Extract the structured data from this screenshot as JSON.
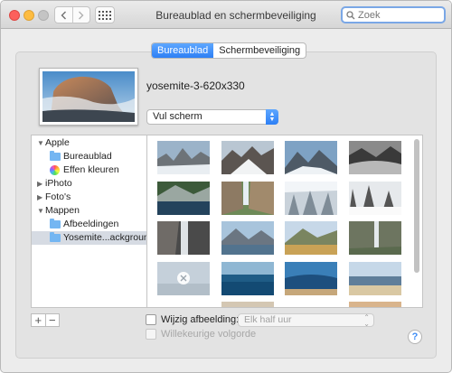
{
  "window": {
    "title": "Bureaublad en schermbeveiliging"
  },
  "search": {
    "placeholder": "Zoek"
  },
  "tabs": [
    {
      "label": "Bureaublad",
      "active": true
    },
    {
      "label": "Schermbeveiliging",
      "active": false
    }
  ],
  "preview": {
    "image_name": "yosemite-3-620x330"
  },
  "fill_popup": {
    "value": "Vul scherm"
  },
  "sidebar": {
    "items": [
      {
        "label": "Apple",
        "level": 0,
        "expanded": true,
        "icon": "disclosure-triangle-down"
      },
      {
        "label": "Bureaublad",
        "level": 1,
        "icon": "folder-icon"
      },
      {
        "label": "Effen kleuren",
        "level": 1,
        "icon": "colorwheel-icon"
      },
      {
        "label": "iPhoto",
        "level": 0,
        "expanded": false,
        "icon": "disclosure-triangle-right"
      },
      {
        "label": "Foto's",
        "level": 0,
        "expanded": false,
        "icon": "disclosure-triangle-right"
      },
      {
        "label": "Mappen",
        "level": 0,
        "expanded": true,
        "icon": "disclosure-triangle-down"
      },
      {
        "label": "Afbeeldingen",
        "level": 1,
        "icon": "folder-icon"
      },
      {
        "label": "Yosemite...ackground",
        "level": 1,
        "icon": "folder-icon",
        "selected": true
      }
    ]
  },
  "buttons": {
    "add": "+",
    "remove": "−",
    "help": "?"
  },
  "change_picture": {
    "label": "Wijzig afbeelding:",
    "checked": false,
    "interval": "Elk half uur"
  },
  "random_order": {
    "label": "Willekeurige volgorde",
    "checked": false,
    "enabled": false
  },
  "colors": {
    "accent": "#2d7ff5",
    "selection": "#d6dbe3",
    "folder": "#74b6f2"
  }
}
